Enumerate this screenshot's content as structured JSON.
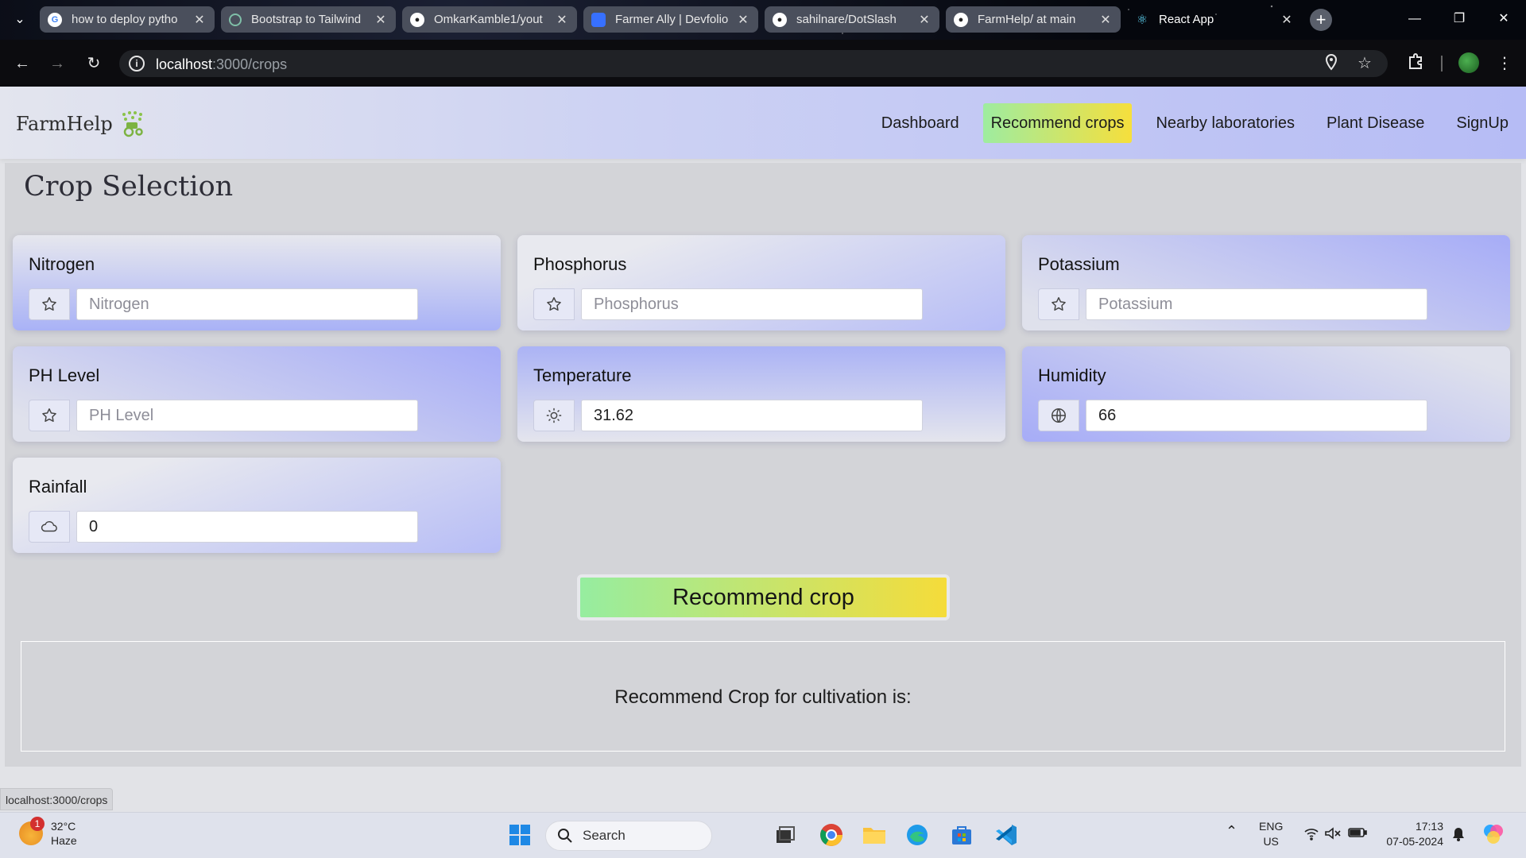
{
  "browser": {
    "tabs": [
      {
        "title": "how to deploy pytho",
        "favicon": "google-icon",
        "color": "#ffffff"
      },
      {
        "title": "Bootstrap to Tailwind",
        "favicon": "chatgpt-icon",
        "color": "#7fbfa8"
      },
      {
        "title": "OmkarKamble1/yout",
        "favicon": "github-icon",
        "color": "#ffffff"
      },
      {
        "title": "Farmer Ally | Devfolio",
        "favicon": "devfolio-icon",
        "color": "#3770ff"
      },
      {
        "title": "sahilnare/DotSlash",
        "favicon": "github-icon",
        "color": "#ffffff"
      },
      {
        "title": "FarmHelp/ at main",
        "favicon": "github-icon",
        "color": "#ffffff"
      },
      {
        "title": "React App",
        "favicon": "react-icon",
        "color": "#61dafb"
      }
    ],
    "url_host": "localhost",
    "url_path": ":3000/crops",
    "status_url": "localhost:3000/crops"
  },
  "app": {
    "brand": "FarmHelp",
    "nav": [
      {
        "label": "Dashboard",
        "active": false
      },
      {
        "label": "Recommend crops",
        "active": true
      },
      {
        "label": "Nearby laboratories",
        "active": false
      },
      {
        "label": "Plant Disease",
        "active": false
      },
      {
        "label": "SignUp",
        "active": false
      }
    ],
    "page_title": "Crop Selection",
    "fields": [
      {
        "label": "Nitrogen",
        "placeholder": "Nitrogen",
        "value": "",
        "icon": "star-icon"
      },
      {
        "label": "Phosphorus",
        "placeholder": "Phosphorus",
        "value": "",
        "icon": "star-icon"
      },
      {
        "label": "Potassium",
        "placeholder": "Potassium",
        "value": "",
        "icon": "star-icon"
      },
      {
        "label": "PH Level",
        "placeholder": "PH Level",
        "value": "",
        "icon": "star-icon"
      },
      {
        "label": "Temperature",
        "placeholder": "",
        "value": "31.62",
        "icon": "sun-icon"
      },
      {
        "label": "Humidity",
        "placeholder": "",
        "value": "66",
        "icon": "globe-icon"
      },
      {
        "label": "Rainfall",
        "placeholder": "",
        "value": "0",
        "icon": "cloud-icon"
      }
    ],
    "recommend_button": "Recommend crop",
    "result_text": "Recommend Crop for cultivation is:"
  },
  "taskbar": {
    "weather_temp": "32°C",
    "weather_desc": "Haze",
    "weather_badge": "1",
    "search_label": "Search",
    "lang_top": "ENG",
    "lang_bottom": "US",
    "time": "17:13",
    "date": "07-05-2024"
  }
}
